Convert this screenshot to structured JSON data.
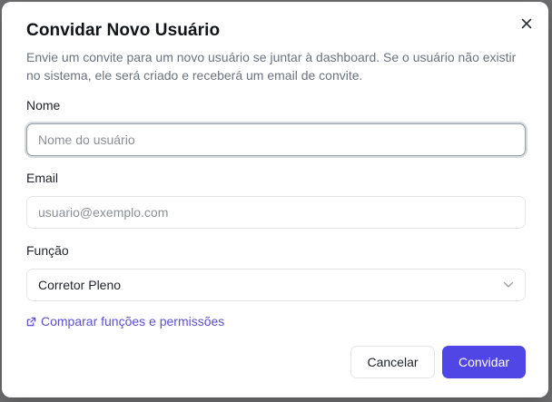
{
  "dialog": {
    "title": "Convidar Novo Usuário",
    "description": "Envie um convite para um novo usuário se juntar à dashboard. Se o usuário não existir no sistema, ele será criado e receberá um email de convite.",
    "close_icon": "close-icon"
  },
  "form": {
    "name": {
      "label": "Nome",
      "placeholder": "Nome do usuário",
      "value": ""
    },
    "email": {
      "label": "Email",
      "placeholder": "usuario@exemplo.com",
      "value": ""
    },
    "role": {
      "label": "Função",
      "selected": "Corretor Pleno",
      "icon": "chevron-down-icon"
    }
  },
  "link": {
    "text": "Comparar funções e permissões",
    "icon": "external-link-icon"
  },
  "actions": {
    "cancel_label": "Cancelar",
    "invite_label": "Convidar"
  },
  "colors": {
    "accent": "#5046e5",
    "link": "#5b4fd9",
    "overlay": "#6f6f72"
  }
}
